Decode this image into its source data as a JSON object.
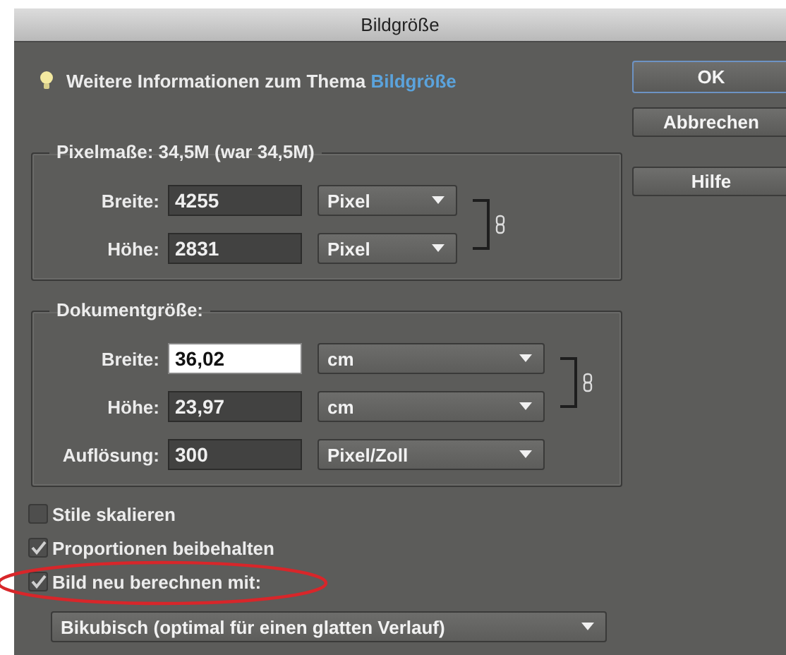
{
  "window": {
    "title": "Bildgröße"
  },
  "info": {
    "text": "Weitere Informationen zum Thema",
    "link": "Bildgröße"
  },
  "buttons": [
    {
      "label": "OK",
      "default": true
    },
    {
      "label": "Abbrechen",
      "default": false
    },
    {
      "label": "Hilfe",
      "default": false
    }
  ],
  "pixel_dimensions": {
    "title": "Pixelmaße: 34,5M (war 34,5M)",
    "rows": [
      {
        "label": "Breite:",
        "value": "4255",
        "unit": "Pixel",
        "focused": false,
        "linked": true
      },
      {
        "label": "Höhe:",
        "value": "2831",
        "unit": "Pixel",
        "focused": false,
        "linked": true
      }
    ]
  },
  "document_size": {
    "title": "Dokumentgröße:",
    "rows": [
      {
        "label": "Breite:",
        "value": "36,02",
        "unit": "cm",
        "focused": true,
        "linked": true
      },
      {
        "label": "Höhe:",
        "value": "23,97",
        "unit": "cm",
        "focused": false,
        "linked": true
      },
      {
        "label": "Auflösung:",
        "value": "300",
        "unit": "Pixel/Zoll",
        "focused": false,
        "linked": false
      }
    ]
  },
  "options": [
    {
      "label": "Stile skalieren",
      "checked": false,
      "highlighted": false
    },
    {
      "label": "Proportionen beibehalten",
      "checked": true,
      "highlighted": false
    },
    {
      "label": "Bild neu berechnen mit:",
      "checked": true,
      "highlighted": true
    }
  ],
  "resample": {
    "value": "Bikubisch (optimal für einen glatten Verlauf)"
  }
}
